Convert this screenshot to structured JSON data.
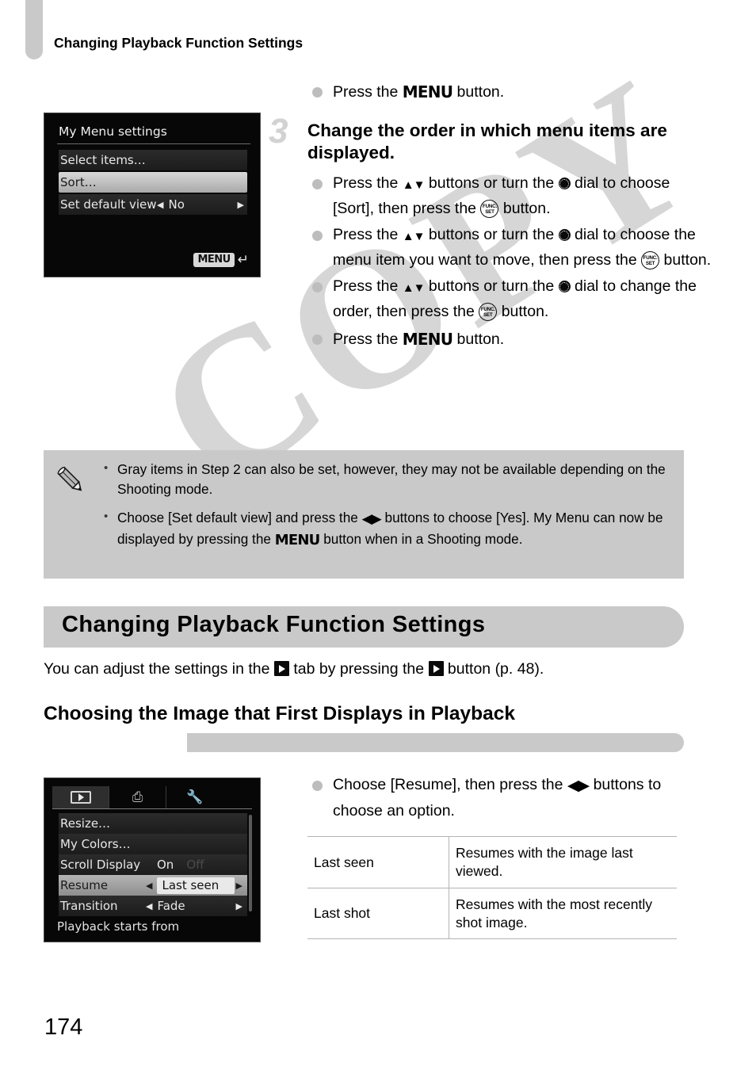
{
  "page": {
    "running_header": "Changing Playback Function Settings",
    "page_number": "174",
    "watermark": "COPY"
  },
  "lcd_my_menu": {
    "title": "My Menu settings",
    "rows": [
      {
        "label": "Select items…",
        "value": "",
        "state": "normal"
      },
      {
        "label": "Sort…",
        "value": "",
        "state": "selected"
      },
      {
        "label": "Set default view",
        "value": "No",
        "state": "normal"
      }
    ],
    "menu_badge": "MENU",
    "return_arrow": "↶"
  },
  "lcd_playback": {
    "tabs": [
      {
        "icon": "playback-tab-icon",
        "active": true
      },
      {
        "icon": "print-tab-icon",
        "active": false
      },
      {
        "icon": "settings-tab-icon",
        "active": false
      }
    ],
    "rows": [
      {
        "label": "Resize…",
        "value": "",
        "ghost": "",
        "state": "normal"
      },
      {
        "label": "My Colors…",
        "value": "",
        "ghost": "",
        "state": "normal"
      },
      {
        "label": "Scroll Display",
        "value": "On",
        "ghost": "Off",
        "state": "normal"
      },
      {
        "label": "Resume",
        "value": "Last seen",
        "ghost": "",
        "state": "selected"
      },
      {
        "label": "Transition",
        "value": "Fade",
        "ghost": "",
        "state": "normal"
      }
    ],
    "footer": "Playback starts from"
  },
  "step_intro": {
    "text_before": "Press the ",
    "icon": "menu-icon",
    "icon_label": "MENU",
    "text_after": " button."
  },
  "step3": {
    "number": "3",
    "title": "Change the order in which menu items are displayed.",
    "bullets": [
      {
        "parts": [
          {
            "t": "text",
            "v": "Press the "
          },
          {
            "t": "icon",
            "v": "up-down-buttons-icon",
            "glyph": "▲▼"
          },
          {
            "t": "text",
            "v": " buttons or turn the "
          },
          {
            "t": "icon",
            "v": "control-dial-icon"
          },
          {
            "t": "text",
            "v": " dial to choose [Sort], then press the "
          },
          {
            "t": "icon",
            "v": "func-set-icon",
            "glyph_top": "FUNC.",
            "glyph_bottom": "SET"
          },
          {
            "t": "text",
            "v": " button."
          }
        ]
      },
      {
        "parts": [
          {
            "t": "text",
            "v": "Press the "
          },
          {
            "t": "icon",
            "v": "up-down-buttons-icon",
            "glyph": "▲▼"
          },
          {
            "t": "text",
            "v": " buttons or turn the "
          },
          {
            "t": "icon",
            "v": "control-dial-icon"
          },
          {
            "t": "text",
            "v": " dial to choose the menu item you want to move, then press the "
          },
          {
            "t": "icon",
            "v": "func-set-icon",
            "glyph_top": "FUNC.",
            "glyph_bottom": "SET"
          },
          {
            "t": "text",
            "v": " button."
          }
        ]
      },
      {
        "parts": [
          {
            "t": "text",
            "v": "Press the "
          },
          {
            "t": "icon",
            "v": "up-down-buttons-icon",
            "glyph": "▲▼"
          },
          {
            "t": "text",
            "v": " buttons or turn the "
          },
          {
            "t": "icon",
            "v": "control-dial-icon"
          },
          {
            "t": "text",
            "v": " dial to change the order, then press the "
          },
          {
            "t": "icon",
            "v": "func-set-icon",
            "glyph_top": "FUNC.",
            "glyph_bottom": "SET"
          },
          {
            "t": "text",
            "v": " button."
          }
        ]
      },
      {
        "parts": [
          {
            "t": "text",
            "v": "Press the "
          },
          {
            "t": "icon",
            "v": "menu-icon",
            "glyph": "MENU"
          },
          {
            "t": "text",
            "v": " button."
          }
        ]
      }
    ]
  },
  "note": {
    "icon": "pencil-icon",
    "items": [
      {
        "text_1": "Gray items in Step 2 can also be set, however, they may not be available depending on the Shooting mode.",
        "has_icons": false
      },
      {
        "text_1": "Choose [Set default view] and press the ",
        "icon_1": "left-right-buttons-icon",
        "text_2": " buttons to choose [Yes]. My Menu can now be displayed by pressing the ",
        "icon_2": "menu-icon",
        "icon_2_label": "MENU",
        "text_3": " button when in a Shooting mode.",
        "has_icons": true
      }
    ]
  },
  "section": {
    "title": "Changing Playback Function Settings",
    "lede_before": "You can adjust the settings in the ",
    "lede_mid": " tab by pressing the ",
    "lede_after": " button (p. 48)."
  },
  "subsection": {
    "title": "Choosing the Image that First Displays in Playback"
  },
  "playback_instruction": {
    "text_before": "Choose [Resume], then press the ",
    "icon": "left-right-buttons-icon",
    "text_after": " buttons to choose an option."
  },
  "options_table": {
    "rows": [
      {
        "key": "Last seen",
        "desc": "Resumes with the image last viewed."
      },
      {
        "key": "Last shot",
        "desc": "Resumes with the most recently shot image."
      }
    ]
  },
  "colors": {
    "gray_panel": "#c9c9c9",
    "bullet_gray": "#bdbdbd",
    "step_num_gray": "#d2d2d2",
    "lcd_black": "#070707"
  }
}
